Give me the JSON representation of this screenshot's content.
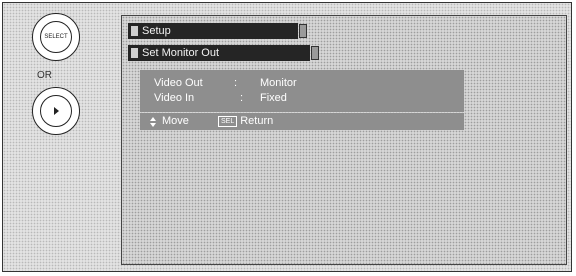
{
  "remote": {
    "or_label": "OR",
    "button1_icon": "select-button-icon",
    "button2_icon": "play-button-icon"
  },
  "menu": {
    "title": "Setup",
    "submenu": "Set Monitor Out",
    "rows": [
      {
        "label": "Video Out",
        "sep": ":",
        "value": "Monitor"
      },
      {
        "label": "Video In",
        "sep": ":",
        "value": "Fixed"
      }
    ],
    "nav": {
      "move_label": "Move",
      "sel_icon_text": "SEL",
      "return_label": "Return"
    }
  }
}
